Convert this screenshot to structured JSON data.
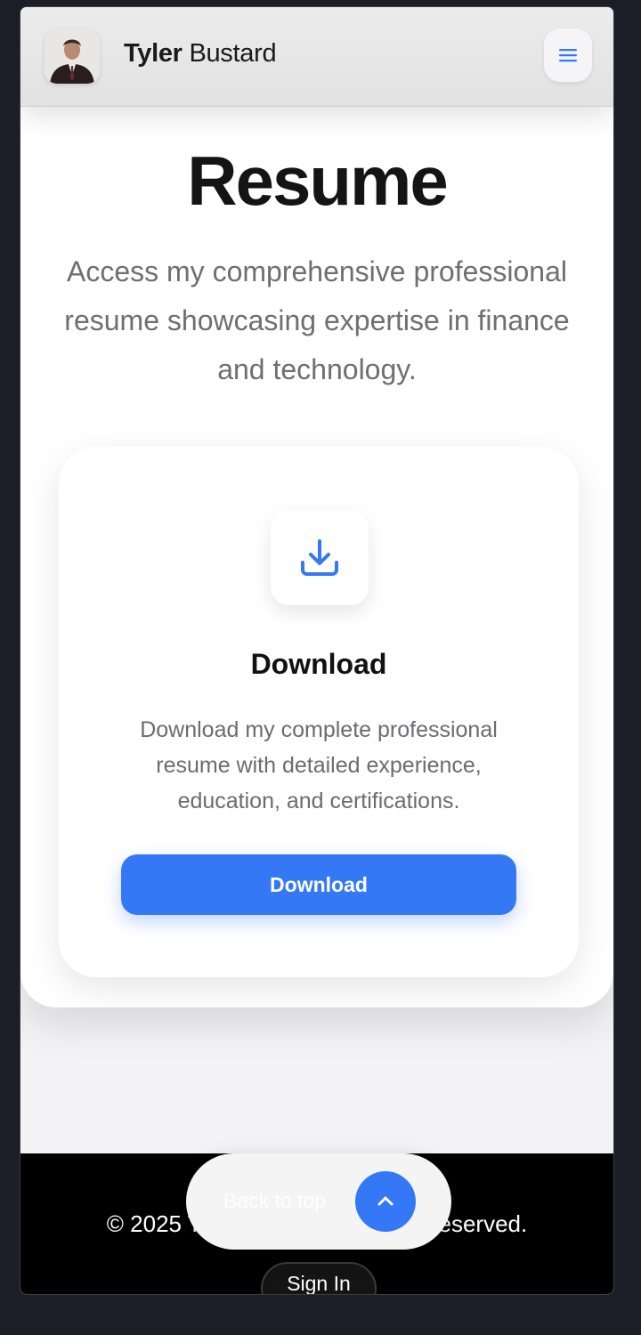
{
  "header": {
    "brand_first": "Tyler",
    "brand_last": "Bustard",
    "menu_icon": "hamburger-icon"
  },
  "main": {
    "title": "Resume",
    "intro": "Access my comprehensive professional resume showcasing expertise in finance and technology."
  },
  "card": {
    "icon": "download-icon",
    "title": "Download",
    "description": "Download my complete professional resume with detailed experience, education, and certifications.",
    "button_label": "Download"
  },
  "footer": {
    "copyright": "© 2025 Tyler Bustard. All rights reserved.",
    "signin_label": "Sign In"
  },
  "back_to_top": {
    "label": "Back to top",
    "icon": "chevron-up-icon"
  },
  "colors": {
    "accent": "#3478f6",
    "footer_bg": "#000000",
    "page_bg": "#1b1e26"
  }
}
